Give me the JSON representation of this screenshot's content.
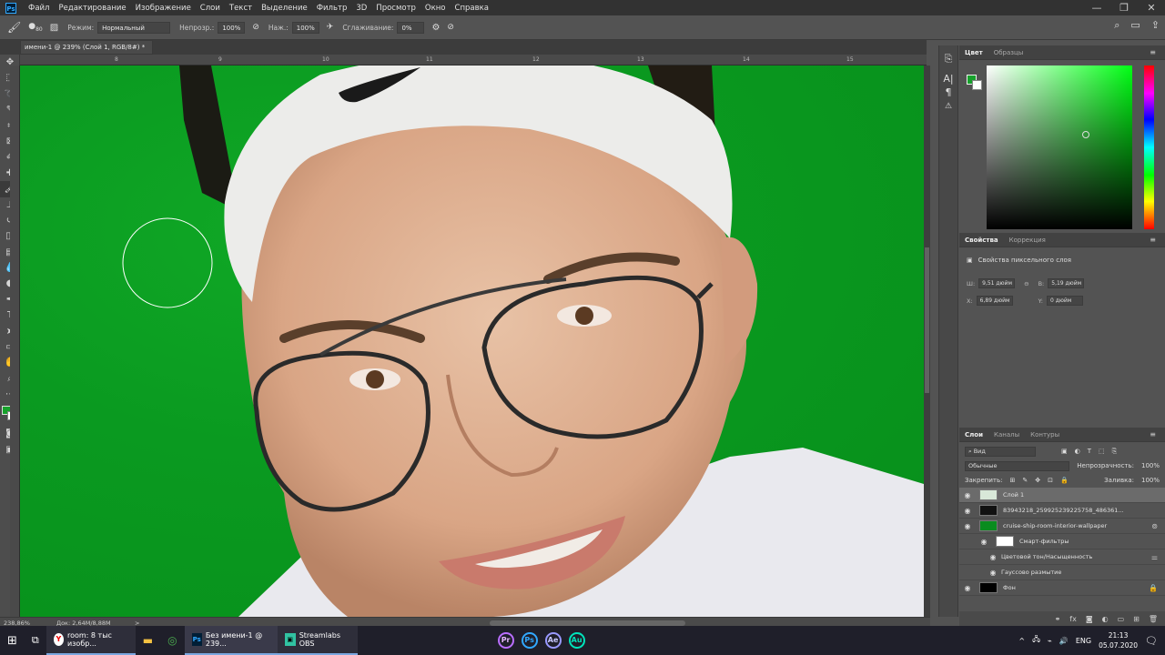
{
  "app": {
    "logo": "Ps"
  },
  "menu": [
    "Файл",
    "Редактирование",
    "Изображение",
    "Слои",
    "Текст",
    "Выделение",
    "Фильтр",
    "3D",
    "Просмотр",
    "Окно",
    "Справка"
  ],
  "window_controls": {
    "minimize": "—",
    "restore": "❐",
    "close": "✕"
  },
  "options_bar": {
    "brush_size": "80",
    "mode_label": "Режим:",
    "mode_value": "Нормальный",
    "opacity_label": "Непрозр.:",
    "opacity_value": "100%",
    "pressure_label": "Наж.:",
    "pressure_value": "100%",
    "smoothing_label": "Сглаживание:",
    "smoothing_value": "0%"
  },
  "document_tab": {
    "title": "имени-1 @ 239% (Слой 1, RGB/8#) *",
    "close": "×"
  },
  "ruler": {
    "ticks": [
      "8",
      "9",
      "10",
      "11",
      "12",
      "13",
      "14",
      "15"
    ]
  },
  "status_bar": {
    "zoom": "238,86%",
    "doc": "Док: 2,64M/8,88M"
  },
  "colors": {
    "foreground": "#17a12c",
    "background": "#ffffff",
    "accent": "#31a8ff"
  },
  "color_panel": {
    "tabs": [
      "Цвет",
      "Образцы"
    ]
  },
  "properties_panel": {
    "tabs": [
      "Свойства",
      "Коррекция"
    ],
    "title": "Свойства пиксельного слоя",
    "w_label": "Ш:",
    "w_value": "9,51 дюйм",
    "h_label": "В:",
    "h_value": "5,19 дюйм",
    "x_label": "X:",
    "x_value": "6,89 дюйм",
    "y_label": "Y:",
    "y_value": "0 дюйм"
  },
  "layers_panel": {
    "tabs": [
      "Слои",
      "Каналы",
      "Контуры"
    ],
    "filter": "Вид",
    "blend_mode": "Обычные",
    "opacity_label": "Непрозрачность:",
    "opacity_value": "100%",
    "lock_label": "Закрепить:",
    "fill_label": "Заливка:",
    "fill_value": "100%",
    "layers": [
      {
        "name": "Слой 1",
        "thumb": "#d8e8d8",
        "eye": true
      },
      {
        "name": "83943218_259925239225758_486361...",
        "thumb": "#111111",
        "eye": true
      },
      {
        "name": "cruise-ship-room-interior-wallpaper",
        "thumb": "#0a8c1e",
        "eye": true
      },
      {
        "name": "Смарт-фильтры",
        "thumb": "#ffffff",
        "eye": true
      },
      {
        "name": "Цветовой тон/Насыщенность",
        "eye": true
      },
      {
        "name": "Гауссово размытие",
        "eye": true
      },
      {
        "name": "Фон",
        "thumb": "#000000",
        "eye": true
      }
    ]
  },
  "taskbar": {
    "items": [
      {
        "label": "room: 8 тыс изобр...",
        "icon": "yandex-icon"
      },
      {
        "label": "Без имени-1 @ 239...",
        "icon": "photoshop-icon"
      },
      {
        "label": "Streamlabs OBS",
        "icon": "streamlabs-icon"
      }
    ],
    "pinned": [
      "Pr",
      "Ps",
      "Ae",
      "Au"
    ],
    "language": "ENG",
    "time": "21:13",
    "date": "05.07.2020"
  }
}
